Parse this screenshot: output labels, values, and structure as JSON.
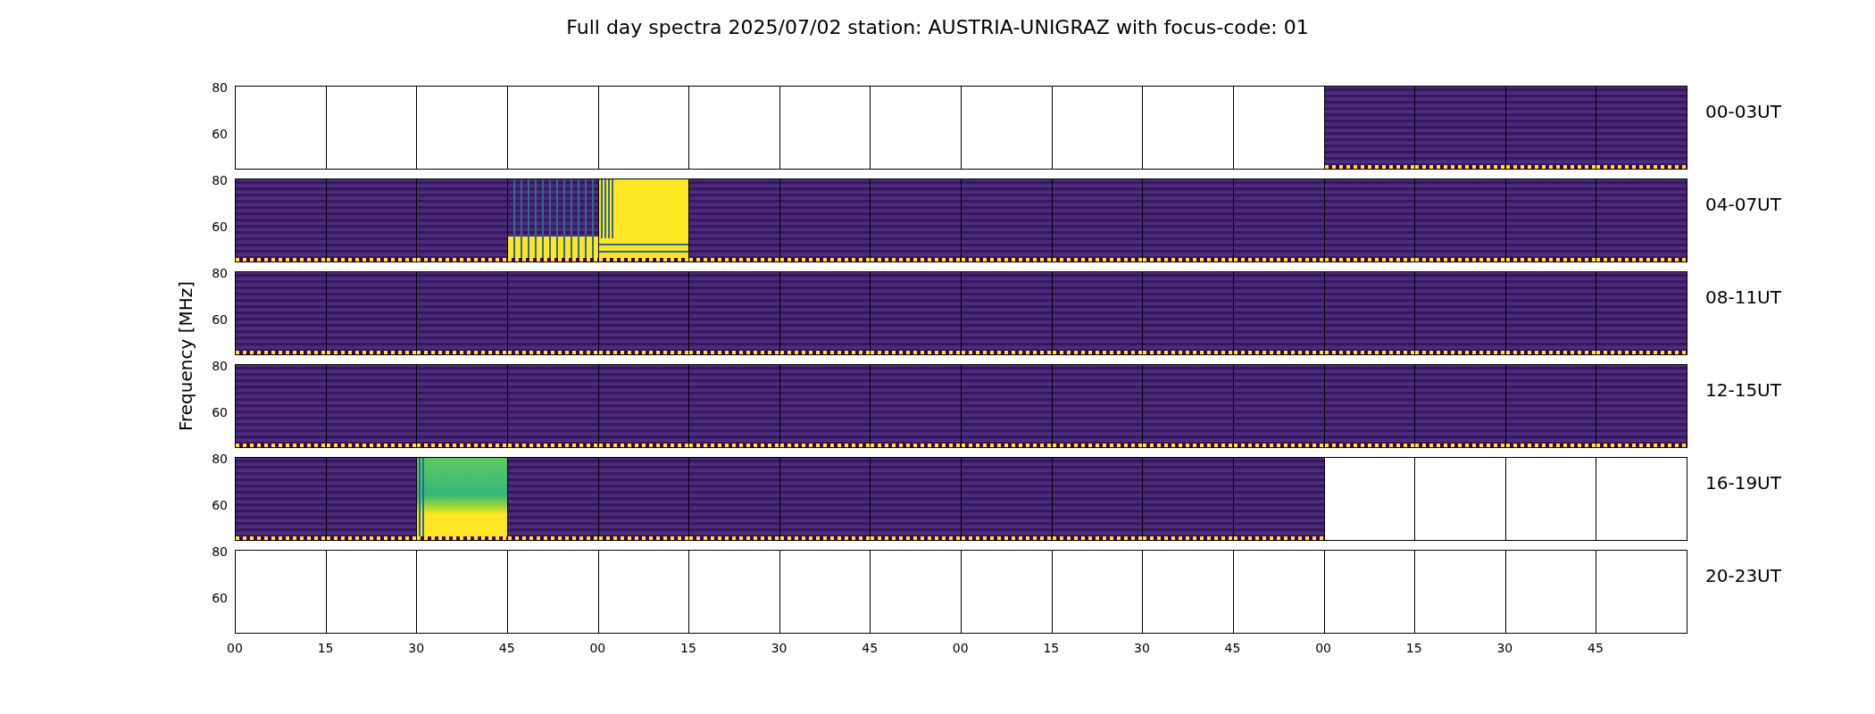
{
  "title": "Full day spectra 2025/07/02 station: AUSTRIA-UNIGRAZ with focus-code: 01",
  "ylabel": "Frequency [MHz]",
  "rows": [
    {
      "label": "00-03UT",
      "yticks": [
        "80",
        "60"
      ],
      "panels": [
        {
          "kind": "empty"
        },
        {
          "kind": "empty"
        },
        {
          "kind": "empty"
        },
        {
          "kind": "empty"
        },
        {
          "kind": "empty"
        },
        {
          "kind": "empty"
        },
        {
          "kind": "empty"
        },
        {
          "kind": "empty"
        },
        {
          "kind": "empty"
        },
        {
          "kind": "empty"
        },
        {
          "kind": "empty"
        },
        {
          "kind": "empty"
        },
        {
          "kind": "spectrum"
        },
        {
          "kind": "spectrum"
        },
        {
          "kind": "spectrum"
        },
        {
          "kind": "spectrum"
        }
      ]
    },
    {
      "label": "04-07UT",
      "yticks": [
        "80",
        "60"
      ],
      "panels": [
        {
          "kind": "spectrum"
        },
        {
          "kind": "spectrum"
        },
        {
          "kind": "spectrum"
        },
        {
          "kind": "lowburst"
        },
        {
          "kind": "saturated"
        },
        {
          "kind": "spectrum"
        },
        {
          "kind": "spectrum"
        },
        {
          "kind": "spectrum"
        },
        {
          "kind": "spectrum"
        },
        {
          "kind": "spectrum"
        },
        {
          "kind": "spectrum"
        },
        {
          "kind": "spectrum"
        },
        {
          "kind": "spectrum"
        },
        {
          "kind": "spectrum"
        },
        {
          "kind": "spectrum"
        },
        {
          "kind": "spectrum"
        }
      ]
    },
    {
      "label": "08-11UT",
      "yticks": [
        "80",
        "60"
      ],
      "panels": [
        {
          "kind": "spectrum"
        },
        {
          "kind": "spectrum"
        },
        {
          "kind": "spectrum"
        },
        {
          "kind": "spectrum"
        },
        {
          "kind": "spectrum"
        },
        {
          "kind": "spectrum"
        },
        {
          "kind": "spectrum"
        },
        {
          "kind": "spectrum"
        },
        {
          "kind": "spectrum"
        },
        {
          "kind": "spectrum"
        },
        {
          "kind": "spectrum"
        },
        {
          "kind": "spectrum"
        },
        {
          "kind": "spectrum"
        },
        {
          "kind": "spectrum"
        },
        {
          "kind": "spectrum"
        },
        {
          "kind": "spectrum"
        }
      ]
    },
    {
      "label": "12-15UT",
      "yticks": [
        "80",
        "60"
      ],
      "panels": [
        {
          "kind": "spectrum"
        },
        {
          "kind": "spectrum"
        },
        {
          "kind": "spectrum"
        },
        {
          "kind": "spectrum"
        },
        {
          "kind": "spectrum"
        },
        {
          "kind": "spectrum"
        },
        {
          "kind": "spectrum"
        },
        {
          "kind": "spectrum"
        },
        {
          "kind": "spectrum"
        },
        {
          "kind": "spectrum"
        },
        {
          "kind": "spectrum"
        },
        {
          "kind": "spectrum"
        },
        {
          "kind": "spectrum"
        },
        {
          "kind": "spectrum"
        },
        {
          "kind": "spectrum"
        },
        {
          "kind": "spectrum"
        }
      ]
    },
    {
      "label": "16-19UT",
      "yticks": [
        "80",
        "60"
      ],
      "panels": [
        {
          "kind": "spectrum"
        },
        {
          "kind": "spectrum"
        },
        {
          "kind": "broadburst"
        },
        {
          "kind": "spectrum"
        },
        {
          "kind": "spectrum"
        },
        {
          "kind": "spectrum"
        },
        {
          "kind": "spectrum"
        },
        {
          "kind": "spectrum"
        },
        {
          "kind": "spectrum"
        },
        {
          "kind": "spectrum"
        },
        {
          "kind": "spectrum"
        },
        {
          "kind": "spectrum"
        },
        {
          "kind": "empty"
        },
        {
          "kind": "empty"
        },
        {
          "kind": "empty"
        },
        {
          "kind": "empty"
        }
      ]
    },
    {
      "label": "20-23UT",
      "yticks": [
        "80",
        "60"
      ],
      "panels": [
        {
          "kind": "empty"
        },
        {
          "kind": "empty"
        },
        {
          "kind": "empty"
        },
        {
          "kind": "empty"
        },
        {
          "kind": "empty"
        },
        {
          "kind": "empty"
        },
        {
          "kind": "empty"
        },
        {
          "kind": "empty"
        },
        {
          "kind": "empty"
        },
        {
          "kind": "empty"
        },
        {
          "kind": "empty"
        },
        {
          "kind": "empty"
        },
        {
          "kind": "empty"
        },
        {
          "kind": "empty"
        },
        {
          "kind": "empty"
        },
        {
          "kind": "empty"
        }
      ]
    }
  ],
  "xticks": [
    "00",
    "15",
    "30",
    "45",
    "00",
    "15",
    "30",
    "45",
    "00",
    "15",
    "30",
    "45",
    "00",
    "15",
    "30",
    "45"
  ]
}
